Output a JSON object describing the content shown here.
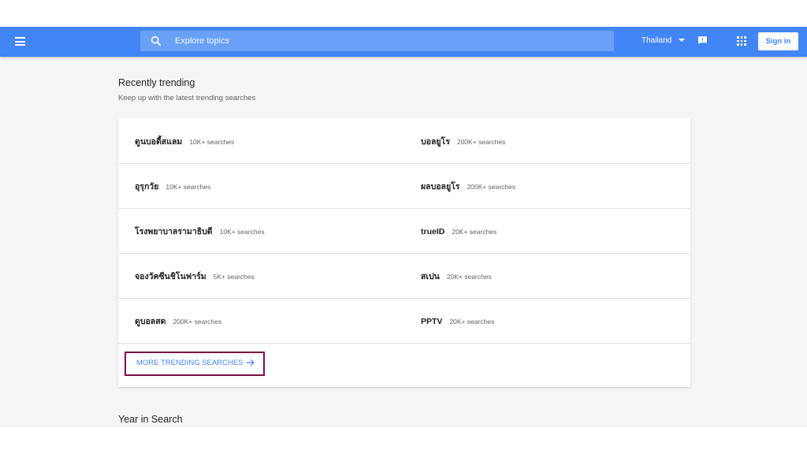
{
  "header": {
    "search_placeholder": "Explore topics",
    "country": "Thailand",
    "signin_label": "Sign in",
    "icons": [
      "menu-icon",
      "search-icon",
      "chevron-down-icon",
      "feedback-icon",
      "apps-icon",
      "arrow-right-icon"
    ],
    "accent_color": "#4285f4"
  },
  "trending": {
    "title": "Recently trending",
    "subtitle": "Keep up with the latest trending searches",
    "rows": [
      {
        "left": {
          "term": "ดูนบอดี้สแลม",
          "count": "10K+ searches"
        },
        "right": {
          "term": "บอลยูโร",
          "count": "200K+ searches"
        }
      },
      {
        "left": {
          "term": "อุรุกวัย",
          "count": "10K+ searches"
        },
        "right": {
          "term": "ผลบอลยูโร",
          "count": "200K+ searches"
        }
      },
      {
        "left": {
          "term": "โรงพยาบาลรามาธิบดี",
          "count": "10K+ searches"
        },
        "right": {
          "term": "trueID",
          "count": "20K+ searches"
        }
      },
      {
        "left": {
          "term": "จองวัคซีนชิโนฟาร์ม",
          "count": "5K+ searches"
        },
        "right": {
          "term": "สเปน",
          "count": "20K+ searches"
        }
      },
      {
        "left": {
          "term": "ดูบอลสด",
          "count": "200K+ searches"
        },
        "right": {
          "term": "PPTV",
          "count": "20K+ searches"
        }
      }
    ],
    "more_label": "MORE TRENDING SEARCHES"
  },
  "year_section": {
    "title": "Year in Search"
  }
}
